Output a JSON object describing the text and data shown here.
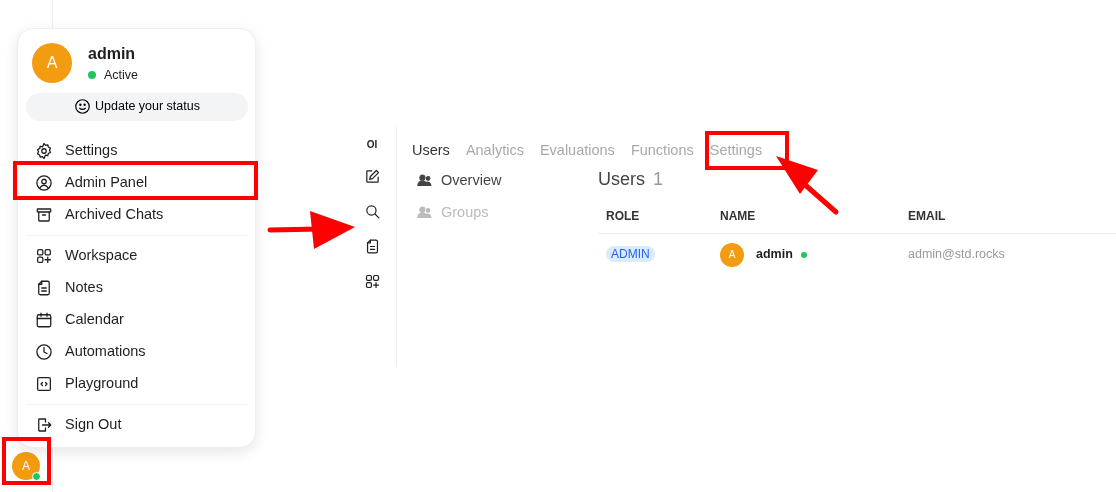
{
  "user_menu": {
    "avatar_initial": "A",
    "name": "admin",
    "status": "Active",
    "online": true,
    "status_button": "Update your status",
    "sections": [
      [
        {
          "label": "Settings"
        },
        {
          "label": "Admin Panel"
        },
        {
          "label": "Archived Chats"
        }
      ],
      [
        {
          "label": "Workspace"
        },
        {
          "label": "Notes"
        },
        {
          "label": "Calendar"
        },
        {
          "label": "Automations"
        },
        {
          "label": "Playground"
        }
      ],
      [
        {
          "label": "Sign Out"
        }
      ]
    ]
  },
  "rail": {
    "avatar_initial": "A",
    "online": true
  },
  "sidebar": {
    "logo": "OI"
  },
  "tabs": [
    {
      "label": "Users",
      "selected": true
    },
    {
      "label": "Analytics",
      "selected": false
    },
    {
      "label": "Evaluations",
      "selected": false
    },
    {
      "label": "Functions",
      "selected": false
    },
    {
      "label": "Settings",
      "selected": false
    }
  ],
  "subnav": [
    {
      "label": "Overview",
      "selected": true
    },
    {
      "label": "Groups",
      "selected": false
    }
  ],
  "users": {
    "title": "Users",
    "count": "1",
    "columns": [
      "ROLE",
      "NAME",
      "EMAIL"
    ],
    "rows": [
      {
        "role": "ADMIN",
        "avatar_initial": "A",
        "name": "admin",
        "online": true,
        "email": "admin@std.rocks"
      }
    ]
  }
}
